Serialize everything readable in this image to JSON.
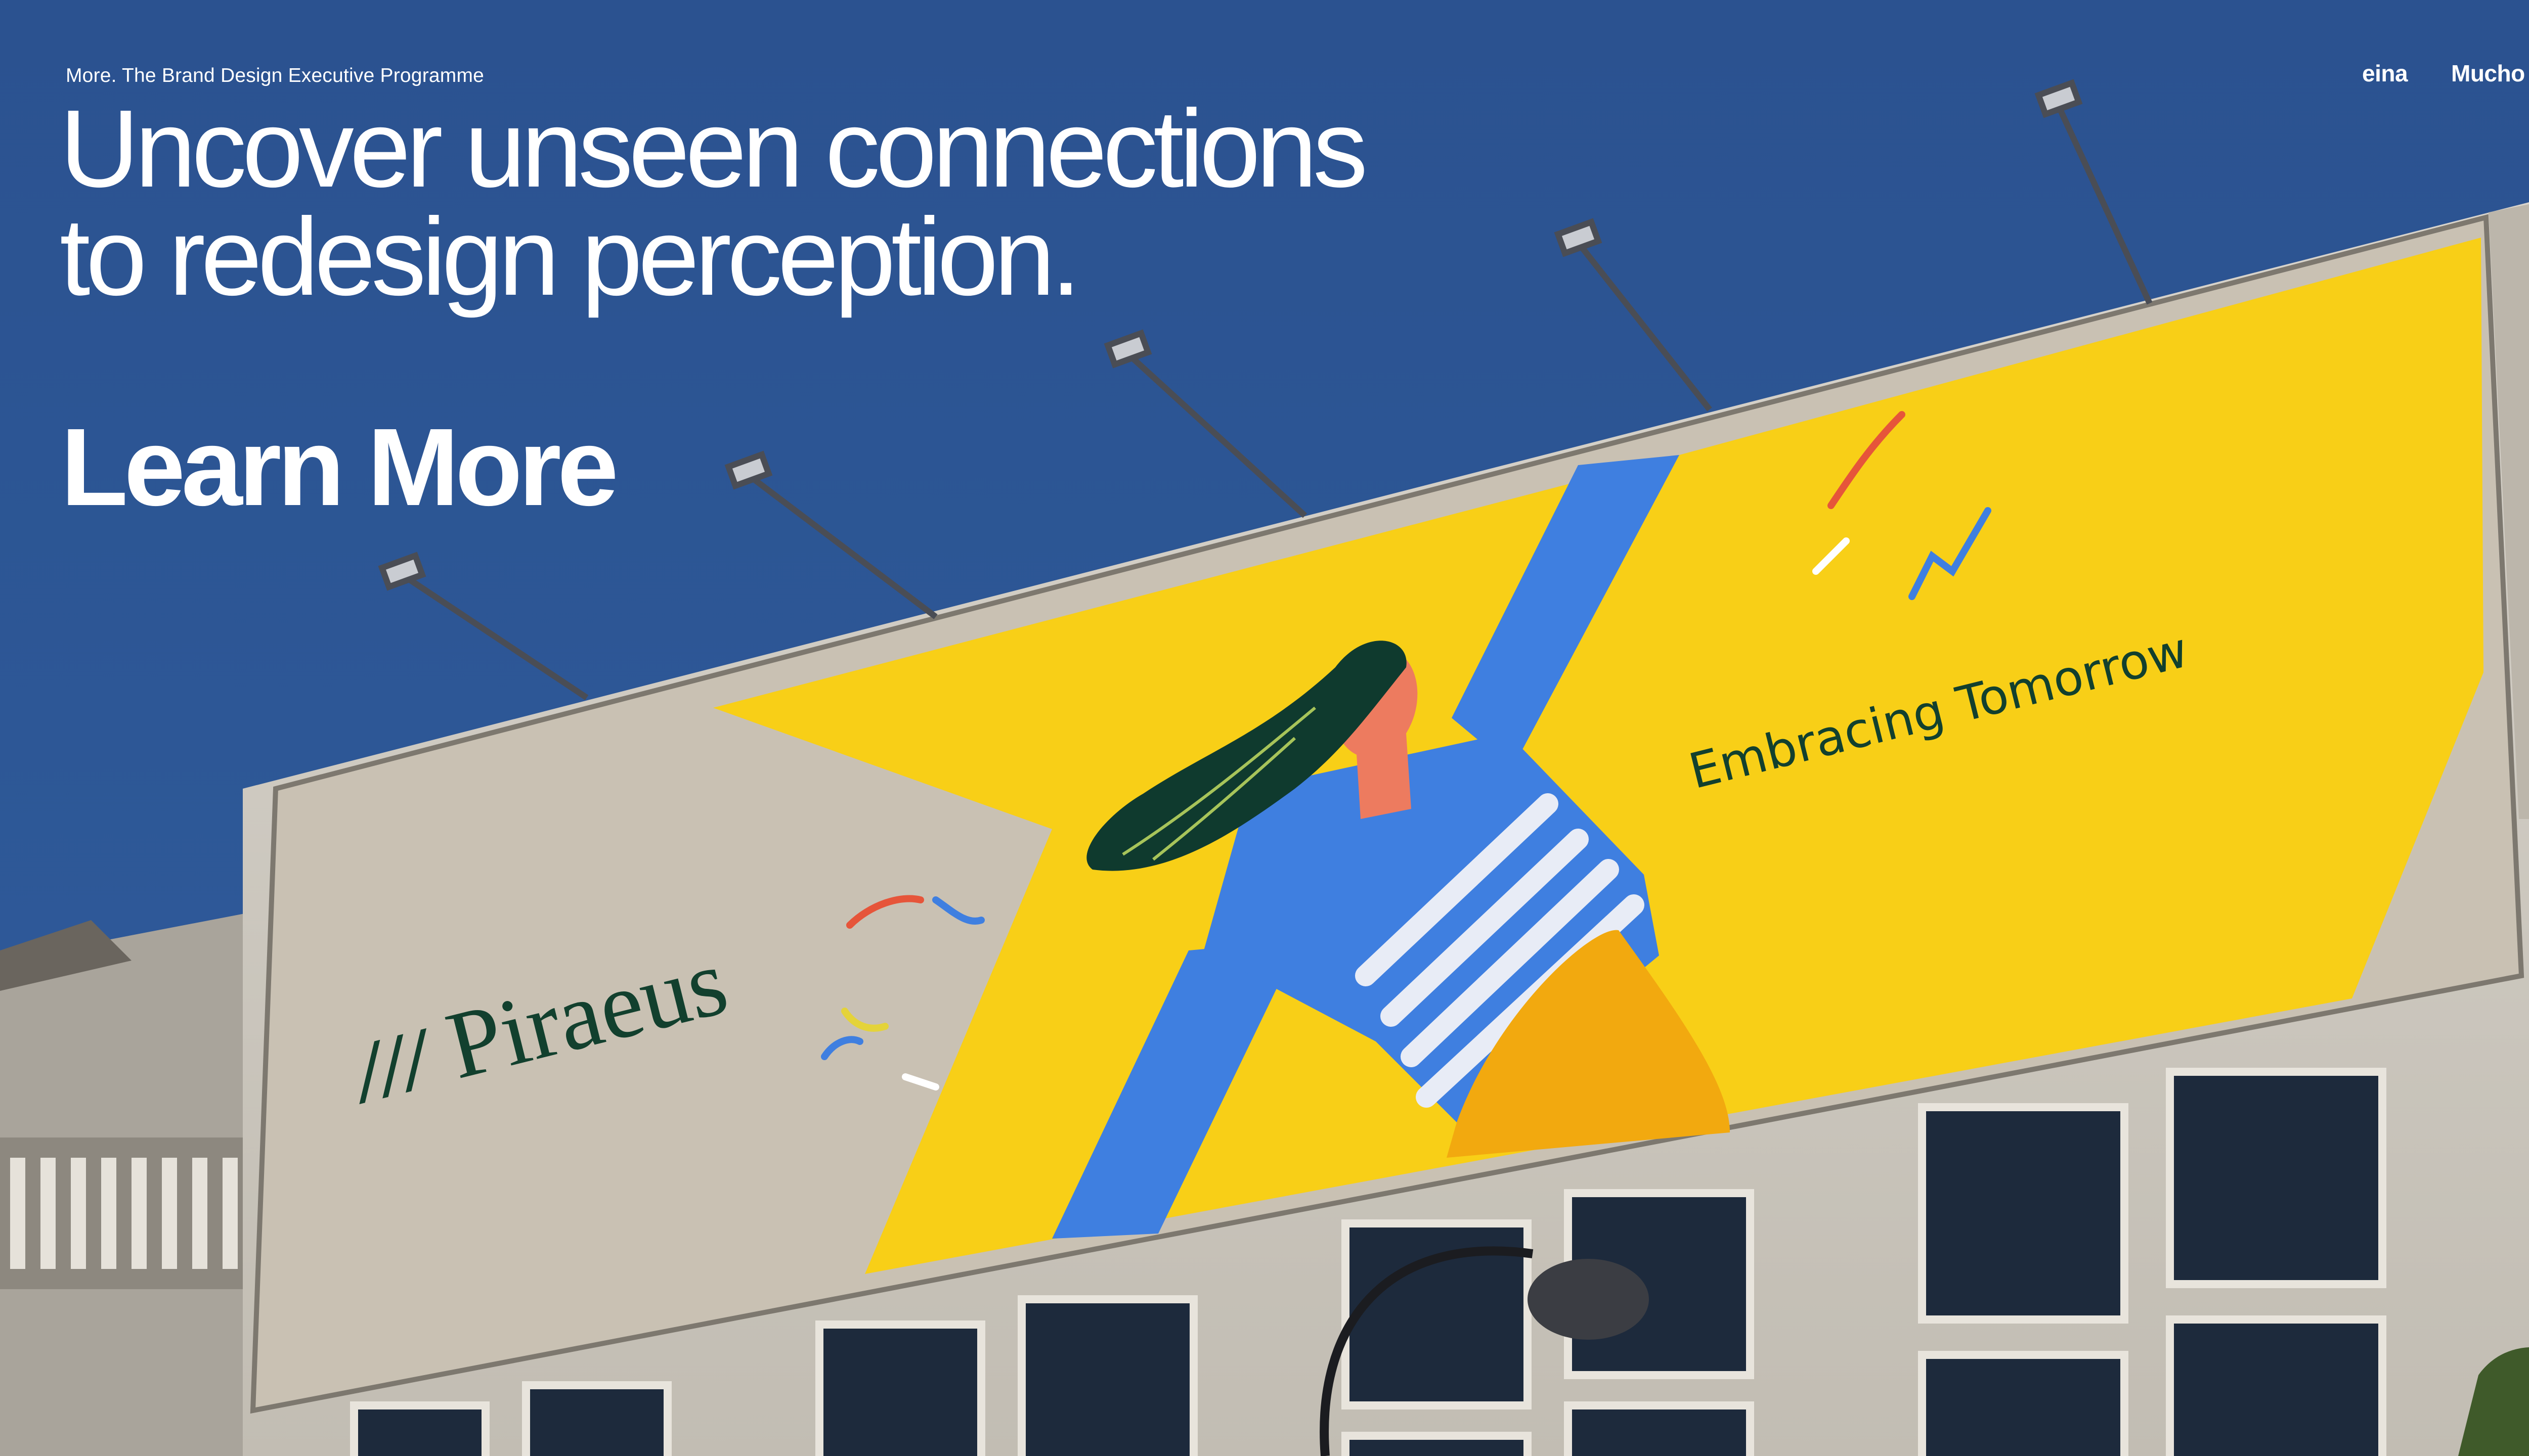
{
  "header": {
    "programme_label": "More. The Brand Design Executive Programme",
    "headline_line1": "Uncover unseen connections",
    "headline_line2": "to redesign perception.",
    "cta_label": "Learn More"
  },
  "partners": {
    "logo_1": "eina",
    "logo_2": "Mucho"
  },
  "billboard": {
    "brand_mark": "///",
    "brand_name": "Piraeus",
    "slogan": "Embracing Tomorrow"
  },
  "colors": {
    "sky": "#2d5796",
    "billboard_yellow": "#f8cf17",
    "billboard_grey": "#c9c1b3",
    "figure_blue": "#3f7fe0",
    "brand_green": "#12402e",
    "text": "#ffffff"
  }
}
